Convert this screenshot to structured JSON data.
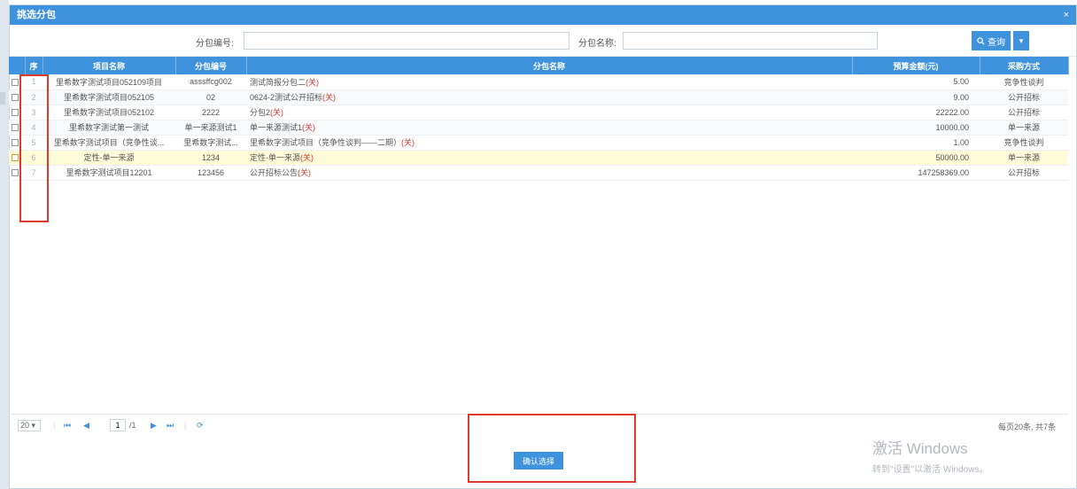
{
  "dialog": {
    "title": "挑选分包",
    "close_symbol": "×"
  },
  "search": {
    "code_label": "分包编号:",
    "code_value": "",
    "name_label": "分包名称:",
    "name_value": "",
    "search_button": "查询",
    "dropdown_symbol": "▾"
  },
  "table": {
    "headers": [
      "",
      "序",
      "项目名称",
      "分包编号",
      "分包名称",
      "预算金额(元)",
      "采购方式"
    ],
    "rows": [
      {
        "idx": "1",
        "project": "里希数字测试项目052109项目",
        "code": "asssffcg002",
        "name": "测试简报分包二",
        "tag": "(关)",
        "amount": "5.00",
        "method": "竞争性谈判",
        "highlight": false
      },
      {
        "idx": "2",
        "project": "里希数字测试项目052105",
        "code": "02",
        "name": "0624-2测试公开招标",
        "tag": "(关)",
        "amount": "9.00",
        "method": "公开招标",
        "highlight": false
      },
      {
        "idx": "3",
        "project": "里希数字测试项目052102",
        "code": "2222",
        "name": "分包2",
        "tag": "(关)",
        "amount": "22222.00",
        "method": "公开招标",
        "highlight": false
      },
      {
        "idx": "4",
        "project": "里希数字测试第一测试",
        "code": "单一来源测试1",
        "name": "单一来源测试1",
        "tag": "(关)",
        "amount": "10000.00",
        "method": "单一来源",
        "highlight": false
      },
      {
        "idx": "5",
        "project": "里希数字测试项目（竞争性谈...",
        "code": "里希数字测试...",
        "name": "里希数字测试项目（竞争性谈判——二期）",
        "tag": "(关)",
        "amount": "1.00",
        "method": "竞争性谈判",
        "highlight": false
      },
      {
        "idx": "6",
        "project": "定性-单一来源",
        "code": "1234",
        "name": "定性-单一来源",
        "tag": "(关)",
        "amount": "50000.00",
        "method": "单一来源",
        "highlight": true
      },
      {
        "idx": "7",
        "project": "里希数字测试项目12201",
        "code": "123456",
        "name": "公开招标公告",
        "tag": "(关)",
        "amount": "147258369.00",
        "method": "公开招标",
        "highlight": false
      }
    ]
  },
  "pager": {
    "page_size": "20 ▾",
    "first": "⏮",
    "prev": "◀",
    "current_page": "1",
    "total_pages": "/1",
    "next": "▶",
    "last": "⏭",
    "refresh": "⟳",
    "info": "每页20条, 共7条"
  },
  "footer": {
    "confirm_button": "确认选择"
  },
  "watermark": {
    "line1": "激活 Windows",
    "line2": "转到\"设置\"以激活 Windows。"
  },
  "colors": {
    "accent": "#3f93dd",
    "annotation": "#e03a2a",
    "highlight_row": "#fdfbd8"
  }
}
